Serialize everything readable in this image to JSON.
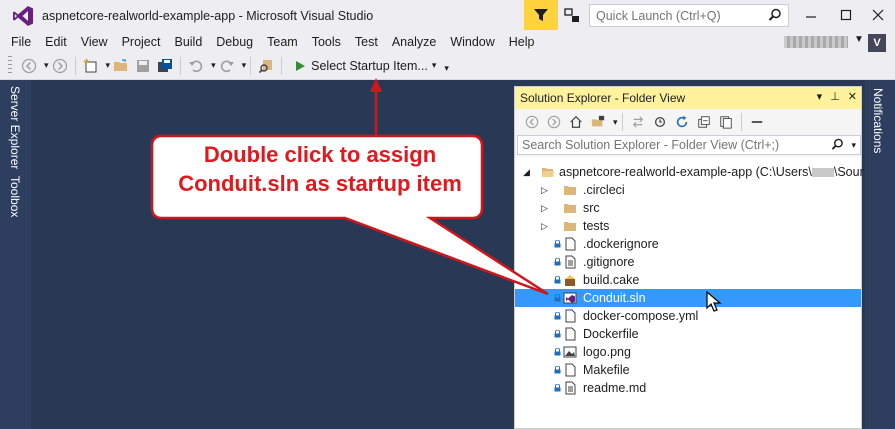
{
  "window": {
    "title": "aspnetcore-realworld-example-app - Microsoft Visual Studio",
    "quick_launch_placeholder": "Quick Launch (Ctrl+Q)",
    "account_initial": "V"
  },
  "menu": [
    "File",
    "Edit",
    "View",
    "Project",
    "Build",
    "Debug",
    "Team",
    "Tools",
    "Test",
    "Analyze",
    "Window",
    "Help"
  ],
  "toolbar": {
    "startup_label": "Select Startup Item..."
  },
  "left_dock": [
    "Server Explorer",
    "Toolbox"
  ],
  "right_dock": [
    "Notifications"
  ],
  "solution_explorer": {
    "title": "Solution Explorer - Folder View",
    "search_placeholder": "Search Solution Explorer - Folder View (Ctrl+;)",
    "root": "aspnetcore-realworld-example-app (C:\\Users\\",
    "root_suffix": "\\Sour",
    "items": [
      {
        "label": ".circleci",
        "kind": "folder"
      },
      {
        "label": "src",
        "kind": "folder"
      },
      {
        "label": "tests",
        "kind": "folder"
      },
      {
        "label": ".dockerignore",
        "kind": "file"
      },
      {
        "label": ".gitignore",
        "kind": "text"
      },
      {
        "label": "build.cake",
        "kind": "cake"
      },
      {
        "label": "Conduit.sln",
        "kind": "sln",
        "selected": true
      },
      {
        "label": "docker-compose.yml",
        "kind": "file"
      },
      {
        "label": "Dockerfile",
        "kind": "file"
      },
      {
        "label": "logo.png",
        "kind": "image"
      },
      {
        "label": "Makefile",
        "kind": "file"
      },
      {
        "label": "readme.md",
        "kind": "text"
      }
    ]
  },
  "callout": {
    "line1": "Double click to assign",
    "line2": "Conduit.sln as startup item"
  },
  "colors": {
    "accent_yellow": "#fff29d",
    "selection": "#3399ff",
    "callout_red": "#e0191e",
    "editor_bg": "#293955"
  }
}
